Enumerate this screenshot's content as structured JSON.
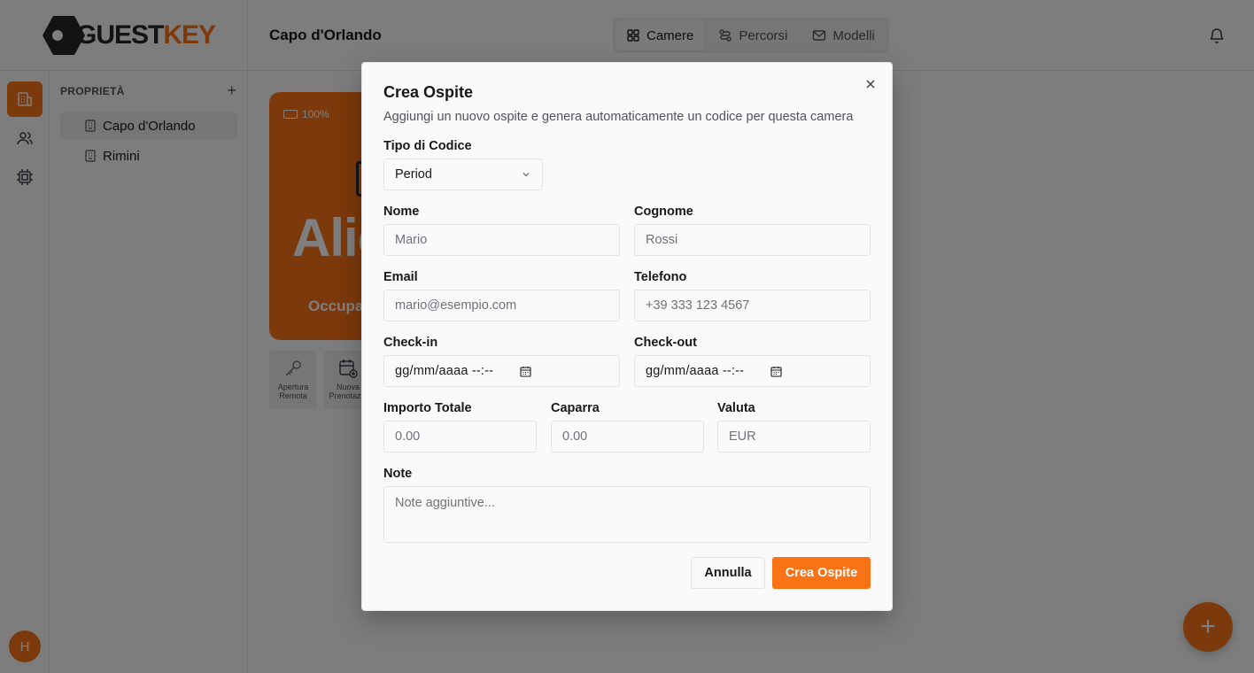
{
  "app": {
    "logo_part1": "GUEST",
    "logo_part2": "KEY",
    "brand_color": "#f97316"
  },
  "header": {
    "title": "Capo d'Orlando",
    "tabs": [
      {
        "label": "Camere",
        "icon": "grid-icon",
        "active": true
      },
      {
        "label": "Percorsi",
        "icon": "route-icon",
        "active": false
      },
      {
        "label": "Modelli",
        "icon": "mail-icon",
        "active": false
      }
    ]
  },
  "sidebar": {
    "heading": "PROPRIETÀ",
    "items": [
      {
        "label": "Capo d'Orlando",
        "active": true
      },
      {
        "label": "Rimini",
        "active": false
      }
    ]
  },
  "user": {
    "initial": "H"
  },
  "room_card": {
    "battery": "100%",
    "name": "Alic",
    "status": "Occupa"
  },
  "actions": [
    {
      "label": "Apertura Remota"
    },
    {
      "label": "Nuova Prenotazio"
    }
  ],
  "dialog": {
    "title": "Crea Ospite",
    "description": "Aggiungi un nuovo ospite e genera automaticamente un codice per questa camera",
    "code_type": {
      "label": "Tipo di Codice",
      "value": "Period"
    },
    "first_name": {
      "label": "Nome",
      "placeholder": "Mario"
    },
    "last_name": {
      "label": "Cognome",
      "placeholder": "Rossi"
    },
    "email": {
      "label": "Email",
      "placeholder": "mario@esempio.com"
    },
    "phone": {
      "label": "Telefono",
      "placeholder": "+39 333 123 4567"
    },
    "checkin": {
      "label": "Check-in",
      "value": "gg/mm/aaaa --:--"
    },
    "checkout": {
      "label": "Check-out",
      "value": "gg/mm/aaaa --:--"
    },
    "total": {
      "label": "Importo Totale",
      "placeholder": "0.00"
    },
    "deposit": {
      "label": "Caparra",
      "placeholder": "0.00"
    },
    "currency": {
      "label": "Valuta",
      "placeholder": "EUR"
    },
    "notes": {
      "label": "Note",
      "placeholder": "Note aggiuntive..."
    },
    "cancel_label": "Annulla",
    "submit_label": "Crea Ospite"
  }
}
